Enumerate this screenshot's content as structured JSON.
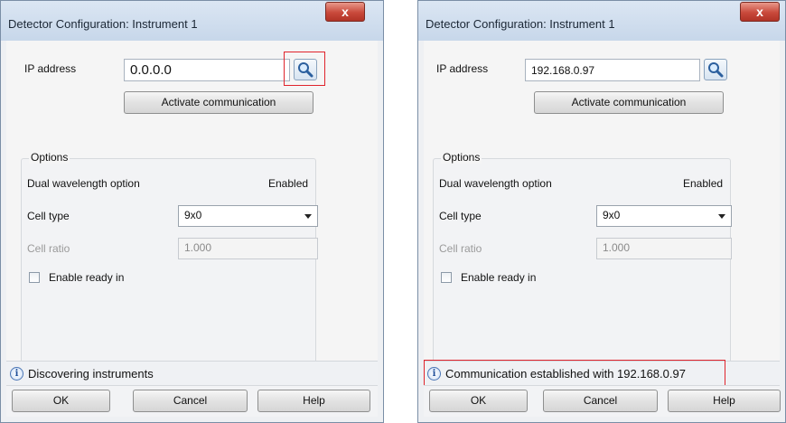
{
  "dialog_left": {
    "title": "Detector Configuration: Instrument 1",
    "close_glyph": "x",
    "ip_label": "IP address",
    "ip_value": "0.0.0.0",
    "search_icon": "magnifier-icon",
    "activate_label": "Activate communication",
    "options_label": "Options",
    "dual_label": "Dual wavelength option",
    "dual_value": "Enabled",
    "cell_type_label": "Cell type",
    "cell_type_value": "9x0",
    "cell_ratio_label": "Cell ratio",
    "cell_ratio_value": "1.000",
    "enable_ready_label": "Enable ready in",
    "status_text": "Discovering instruments",
    "ok_label": "OK",
    "cancel_label": "Cancel",
    "help_label": "Help"
  },
  "dialog_right": {
    "title": "Detector Configuration: Instrument 1",
    "close_glyph": "x",
    "ip_label": "IP address",
    "ip_value": "192.168.0.97",
    "search_icon": "magnifier-icon",
    "activate_label": "Activate communication",
    "options_label": "Options",
    "dual_label": "Dual wavelength option",
    "dual_value": "Enabled",
    "cell_type_label": "Cell type",
    "cell_type_value": "9x0",
    "cell_ratio_label": "Cell ratio",
    "cell_ratio_value": "1.000",
    "enable_ready_label": "Enable ready in",
    "status_text": "Communication established with 192.168.0.97",
    "ok_label": "OK",
    "cancel_label": "Cancel",
    "help_label": "Help"
  },
  "colors": {
    "highlight": "#e0242c",
    "close_button": "#c9493b",
    "titlebar": "#c7d7ea"
  }
}
